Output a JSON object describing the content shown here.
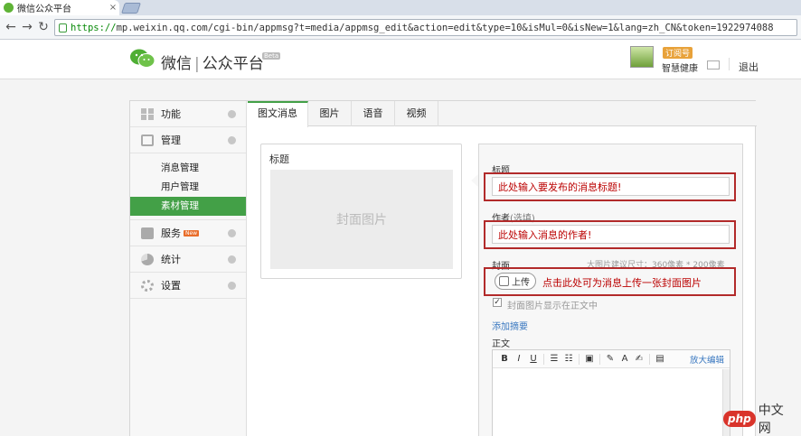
{
  "browser": {
    "tab_title": "微信公众平台",
    "tab_close": "×",
    "url_scheme": "https://",
    "url_rest": "mp.weixin.qq.com/cgi-bin/appmsg?t=media/appmsg_edit&action=edit&type=10&isMul=0&isNew=1&lang=zh_CN&token=1922974088"
  },
  "header": {
    "brand_1": "微信",
    "brand_sep": "|",
    "brand_2": "公众平台",
    "beta": "Beta",
    "subscription_badge": "订阅号",
    "username": "智慧健康",
    "logout": "退出"
  },
  "sidebar": {
    "menus": [
      {
        "label": "功能",
        "icon": "grid-icon"
      },
      {
        "label": "管理",
        "icon": "inbox-icon"
      },
      {
        "label": "服务",
        "icon": "printer-icon",
        "badge": "New"
      },
      {
        "label": "统计",
        "icon": "pie-chart-icon"
      },
      {
        "label": "设置",
        "icon": "gear-icon"
      }
    ],
    "manage_sub": [
      "消息管理",
      "用户管理",
      "素材管理"
    ]
  },
  "tabs": [
    "图文消息",
    "图片",
    "语音",
    "视频"
  ],
  "preview": {
    "title": "标题",
    "cover": "封面图片"
  },
  "form": {
    "title_label": "标题",
    "title_value": "此处输入要发布的消息标题!",
    "author_label": "作者",
    "author_optional": "(选填)",
    "author_value": "此处输入消息的作者!",
    "cover_label": "封面",
    "cover_hint": "大图片建议尺寸：360像素 * 200像素",
    "upload_label": "上传",
    "upload_note": "点击此处可为消息上传一张封面图片",
    "show_cover_label": "封面图片显示在正文中",
    "add_summary": "添加摘要",
    "body_label": "正文",
    "rte_expand": "放大编辑"
  },
  "watermark": {
    "php": "php",
    "cn": "中文网"
  },
  "colors": {
    "accent": "#43a047",
    "highlight": "#b22a2a",
    "link": "#3a78c0"
  }
}
